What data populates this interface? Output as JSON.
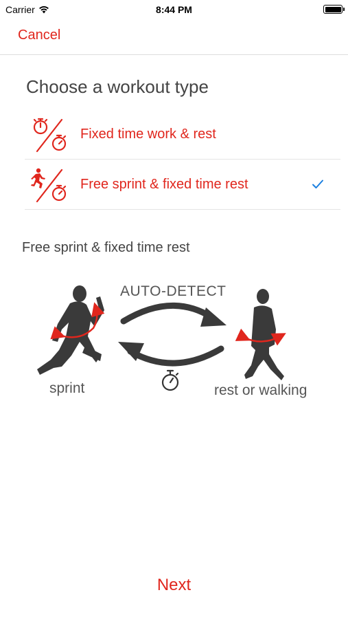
{
  "status_bar": {
    "carrier": "Carrier",
    "time": "8:44 PM",
    "icons": [
      "wifi-icon",
      "battery-icon"
    ]
  },
  "nav": {
    "cancel_label": "Cancel"
  },
  "title": "Choose a workout type",
  "options": [
    {
      "label": "Fixed time work & rest",
      "icon": "double-stopwatch-icon",
      "selected": false
    },
    {
      "label": "Free sprint & fixed time rest",
      "icon": "sprinter-stopwatch-icon",
      "selected": true
    }
  ],
  "description": {
    "title": "Free sprint & fixed time rest",
    "auto_detect": "AUTO-DETECT",
    "sprint_label": "sprint",
    "rest_label": "rest or walking"
  },
  "footer": {
    "next_label": "Next"
  },
  "colors": {
    "accent": "#e0261d",
    "check": "#1a7fe0",
    "silhouette": "#3a3a3a"
  }
}
